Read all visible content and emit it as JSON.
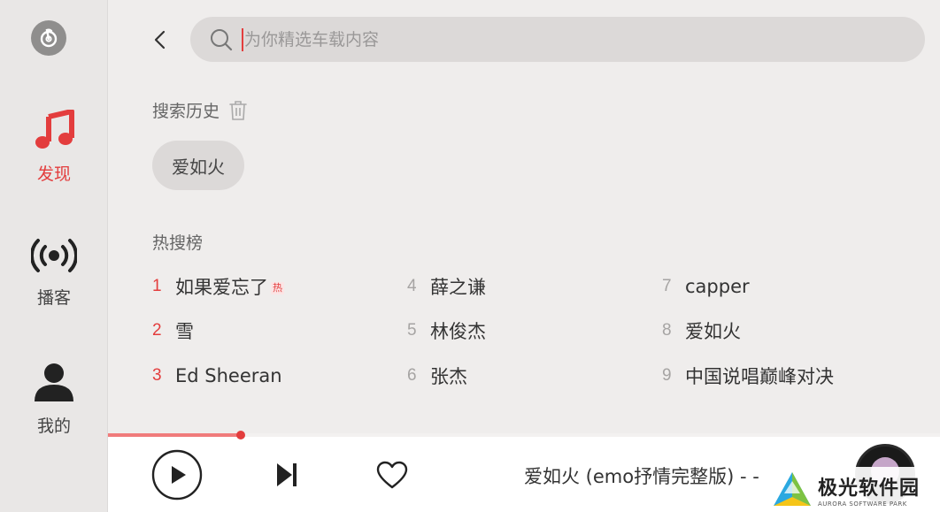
{
  "sidebar": {
    "items": [
      {
        "label": "发现",
        "icon": "music-note-icon",
        "active": true
      },
      {
        "label": "播客",
        "icon": "broadcast-icon",
        "active": false
      },
      {
        "label": "我的",
        "icon": "user-icon",
        "active": false
      }
    ]
  },
  "search": {
    "placeholder": "为你精选车载内容",
    "value": ""
  },
  "history": {
    "title": "搜索历史",
    "items": [
      "爱如火"
    ]
  },
  "hot": {
    "title": "热搜榜",
    "items": [
      {
        "rank": "1",
        "text": "如果爱忘了",
        "badge": "热"
      },
      {
        "rank": "2",
        "text": "雪"
      },
      {
        "rank": "3",
        "text": "Ed Sheeran"
      },
      {
        "rank": "4",
        "text": "薛之谦"
      },
      {
        "rank": "5",
        "text": "林俊杰"
      },
      {
        "rank": "6",
        "text": "张杰"
      },
      {
        "rank": "7",
        "text": "capper"
      },
      {
        "rank": "8",
        "text": "爱如火"
      },
      {
        "rank": "9",
        "text": "中国说唱巅峰对决"
      }
    ]
  },
  "player": {
    "now_playing": "爱如火 (emo抒情完整版) - -",
    "progress": 0.16
  },
  "watermark": {
    "cn": "极光软件园",
    "en": "AURORA SOFTWARE PARK"
  },
  "colors": {
    "accent": "#e33d3d",
    "progress_fill": "#f07b7b"
  }
}
